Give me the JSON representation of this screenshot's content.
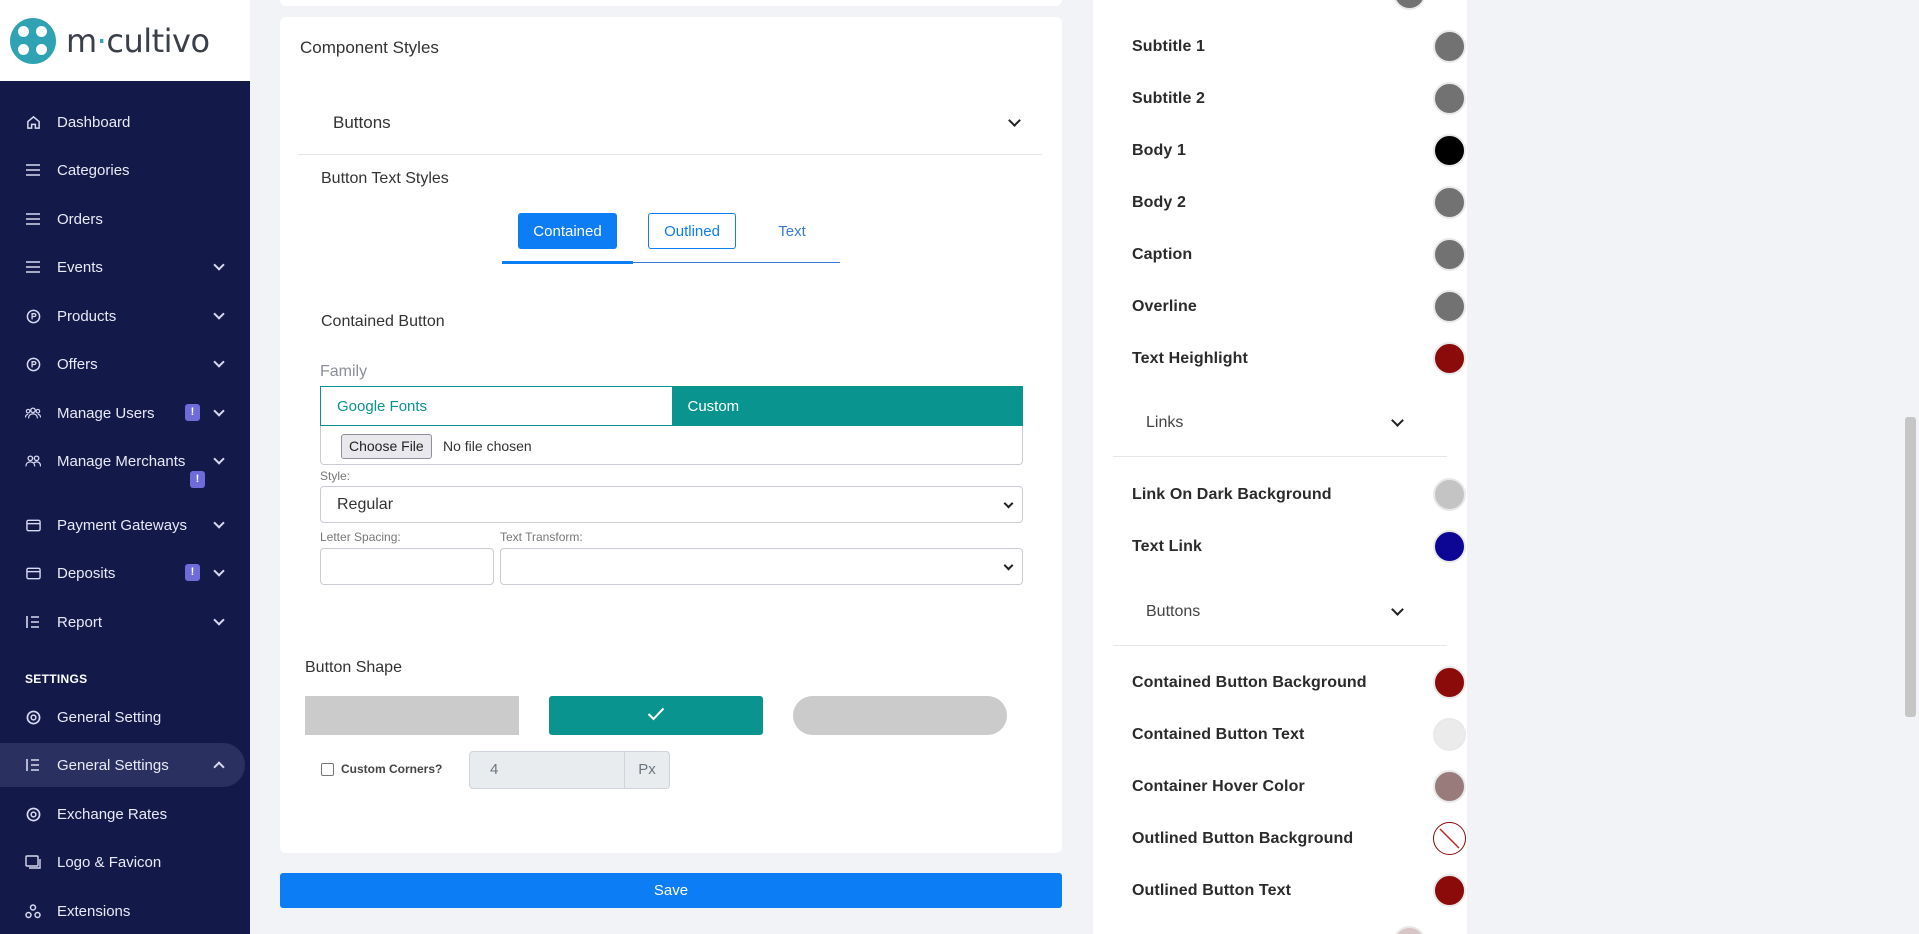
{
  "brand": {
    "name_prefix": "m",
    "name_dot": "·",
    "name_suffix": "cultivo"
  },
  "sidebar": {
    "items": [
      {
        "label": "Dashboard",
        "icon": "home-icon"
      },
      {
        "label": "Categories",
        "icon": "list-icon"
      },
      {
        "label": "Orders",
        "icon": "list-icon"
      },
      {
        "label": "Events",
        "icon": "list-icon"
      },
      {
        "label": "Products",
        "icon": "product-icon"
      },
      {
        "label": "Offers",
        "icon": "offer-icon"
      },
      {
        "label": "Manage Users",
        "icon": "users-icon",
        "badge": "!"
      },
      {
        "label": "Manage Merchants",
        "icon": "merchants-icon",
        "badge": "!"
      },
      {
        "label": "Payment Gateways",
        "icon": "card-icon"
      },
      {
        "label": "Deposits",
        "icon": "card-icon",
        "badge": "!"
      },
      {
        "label": "Report",
        "icon": "report-icon"
      }
    ],
    "section_label": "SETTINGS",
    "settings_items": [
      {
        "label": "General Setting",
        "icon": "settings-icon"
      },
      {
        "label": "General Settings",
        "icon": "report-icon"
      },
      {
        "label": "Exchange Rates",
        "icon": "settings-icon"
      },
      {
        "label": "Logo & Favicon",
        "icon": "image-icon"
      },
      {
        "label": "Extensions",
        "icon": "extensions-icon"
      }
    ]
  },
  "main": {
    "section_title": "Component Styles",
    "accordion_label": "Buttons",
    "text_styles_title": "Button Text Styles",
    "tabs": {
      "contained": "Contained",
      "outlined": "Outlined",
      "text": "Text"
    },
    "contained_title": "Contained Button",
    "family": {
      "label": "Family",
      "option_google": "Google Fonts",
      "option_custom": "Custom",
      "file_button": "Choose File",
      "file_status": "No file chosen"
    },
    "style": {
      "label": "Style:",
      "value": "Regular"
    },
    "letter_spacing": {
      "label": "Letter Spacing:",
      "value": ""
    },
    "text_transform": {
      "label": "Text Transform:",
      "value": ""
    },
    "shape": {
      "title": "Button Shape",
      "custom_corners_label": "Custom Corners?",
      "corner_value": "4",
      "corner_unit": "Px"
    },
    "save_label": "Save"
  },
  "right_panel": {
    "text_colors": [
      {
        "name": "Subtitle 1",
        "color": "#727272"
      },
      {
        "name": "Subtitle 2",
        "color": "#727272"
      },
      {
        "name": "Body 1",
        "color": "#000000"
      },
      {
        "name": "Body 2",
        "color": "#727272"
      },
      {
        "name": "Caption",
        "color": "#727272"
      },
      {
        "name": "Overline",
        "color": "#727272"
      },
      {
        "name": "Text Heighlight",
        "color": "#8b0a0a"
      }
    ],
    "links_header": "Links",
    "link_colors": [
      {
        "name": "Link On Dark Background",
        "color": "#c4c4c4"
      },
      {
        "name": "Text Link",
        "color": "#0d0694"
      }
    ],
    "buttons_header": "Buttons",
    "button_colors": [
      {
        "name": "Contained Button Background",
        "color": "#8b0a0a"
      },
      {
        "name": "Contained Button Text",
        "color": "#ebebeb"
      },
      {
        "name": "Container Hover Color",
        "color": "#9a7b7b"
      },
      {
        "name": "Outlined Button Background",
        "color": "transparent"
      },
      {
        "name": "Outlined Button Text",
        "color": "#8b0a0a"
      }
    ]
  }
}
